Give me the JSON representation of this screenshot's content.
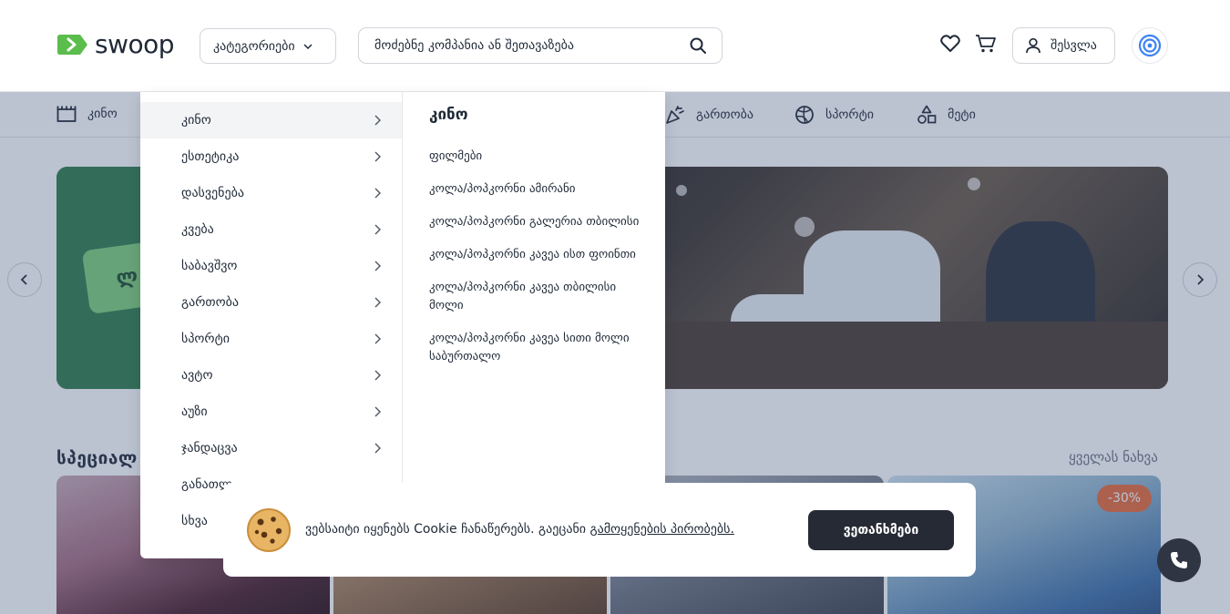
{
  "header": {
    "logo_text": "swoop",
    "categories_label": "კატეგორიები",
    "search_placeholder": "მოძებნე კომპანია ან შეთავაზება",
    "login_label": "შესვლა"
  },
  "catbar": [
    {
      "label": "კინო",
      "icon": "film-icon"
    },
    {
      "label": "გართობა",
      "icon": "party-icon"
    },
    {
      "label": "სპორტი",
      "icon": "ball-icon"
    },
    {
      "label": "მეტი",
      "icon": "shapes-icon"
    }
  ],
  "section": {
    "title": "სპეციალ",
    "see_all": "ყველას ნახვა",
    "discount": "-30%"
  },
  "dropdown": {
    "left_items": [
      {
        "label": "კინო",
        "has_arrow": true,
        "active": true
      },
      {
        "label": "ესთეტიკა",
        "has_arrow": true
      },
      {
        "label": "დასვენება",
        "has_arrow": true
      },
      {
        "label": "კვება",
        "has_arrow": true
      },
      {
        "label": "საბავშვო",
        "has_arrow": true
      },
      {
        "label": "გართობა",
        "has_arrow": true
      },
      {
        "label": "სპორტი",
        "has_arrow": true
      },
      {
        "label": "ავტო",
        "has_arrow": true
      },
      {
        "label": "აუზი",
        "has_arrow": true
      },
      {
        "label": "ჯანდაცვა",
        "has_arrow": true
      },
      {
        "label": "განათლ",
        "has_arrow": false
      },
      {
        "label": "სხვა",
        "has_arrow": false
      }
    ],
    "heading": "კინო",
    "sub_items": [
      "ფილმები",
      "კოლა/პოპკორნი ამირანი",
      "კოლა/პოპკორნი გალერია თბილისი",
      "კოლა/პოპკორნი კავეა ისთ ფოინთი",
      "კოლა/პოპკორნი კავეა თბილისი მოლი",
      "კოლა/პოპკორნი კავეა სითი მოლი საბურთალო"
    ]
  },
  "cookie": {
    "text": "ვებსაიტი იყენებს Cookie ჩანაწერებს. გაეცანი ",
    "link": "გამოყენების პირობებს.",
    "accept": "ვეთანხმები"
  },
  "colors": {
    "brand_green": "#5bbd4c",
    "dark_button": "#262a35",
    "discount": "#e86b3a",
    "accent_blue": "#3b82f6"
  }
}
